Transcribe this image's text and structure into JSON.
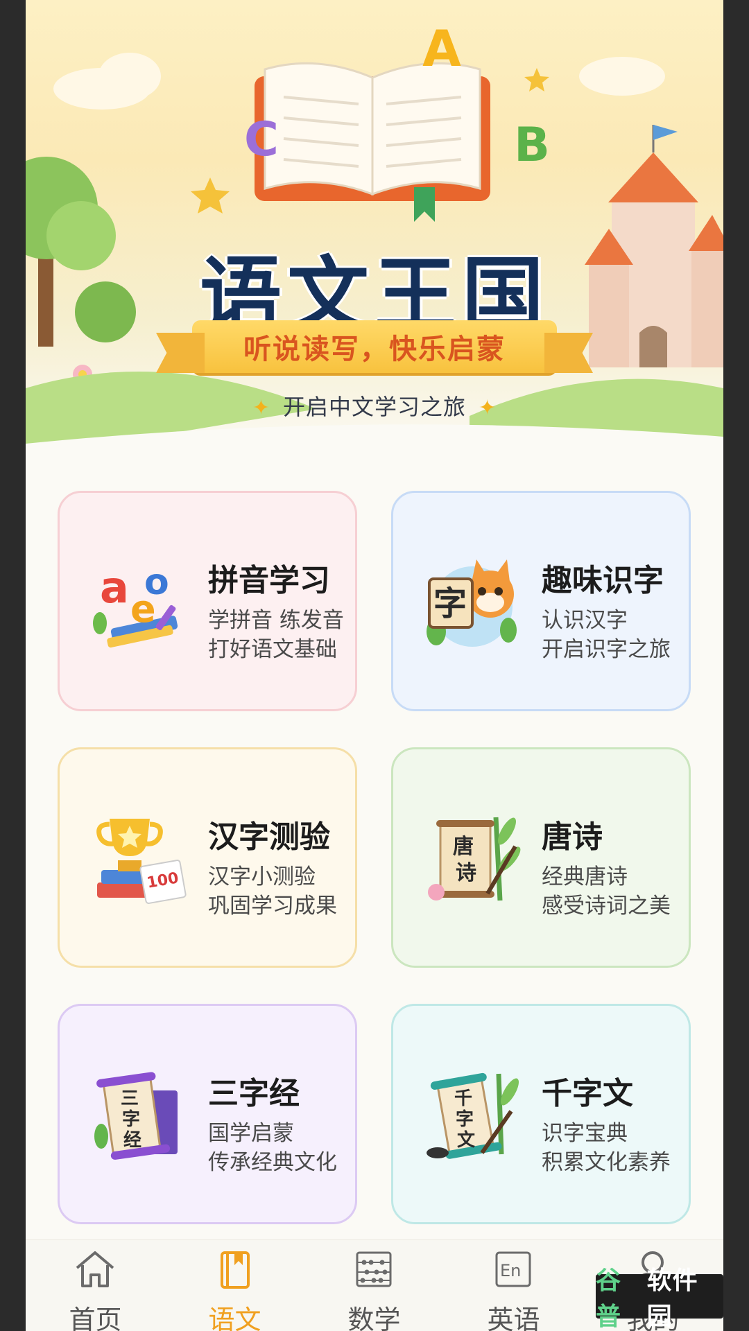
{
  "banner": {
    "title": "语文王国",
    "slogan": "听说读写，快乐启蒙",
    "subtitle": "开启中文学习之旅",
    "letters": [
      "A",
      "B",
      "C"
    ]
  },
  "cards": [
    {
      "title": "拼音学习",
      "line1": "学拼音 练发音",
      "line2": "打好语文基础",
      "icon": "pinyin-aoe-icon",
      "badge": [
        "a",
        "o",
        "e"
      ]
    },
    {
      "title": "趣味识字",
      "line1": "认识汉字",
      "line2": "开启识字之旅",
      "icon": "cat-character-card-icon",
      "badge": [
        "字"
      ]
    },
    {
      "title": "汉字测验",
      "line1": "汉字小测验",
      "line2": "巩固学习成果",
      "icon": "trophy-books-icon",
      "badge": [
        "100"
      ]
    },
    {
      "title": "唐诗",
      "line1": "经典唐诗",
      "line2": "感受诗词之美",
      "icon": "tang-poetry-scroll-icon",
      "badge": [
        "唐",
        "诗"
      ]
    },
    {
      "title": "三字经",
      "line1": "国学启蒙",
      "line2": "传承经典文化",
      "icon": "three-character-classic-scroll-icon",
      "badge": [
        "三",
        "字",
        "经"
      ]
    },
    {
      "title": "千字文",
      "line1": "识字宝典",
      "line2": "积累文化素养",
      "icon": "thousand-character-scroll-icon",
      "badge": [
        "千",
        "字",
        "文"
      ]
    }
  ],
  "nav": [
    {
      "label": "首页",
      "icon": "home-icon",
      "active": false
    },
    {
      "label": "语文",
      "icon": "book-icon",
      "active": true
    },
    {
      "label": "数学",
      "icon": "abacus-icon",
      "active": false
    },
    {
      "label": "英语",
      "icon": "en-icon",
      "active": false
    },
    {
      "label": "我的",
      "icon": "person-icon",
      "active": false
    }
  ],
  "nav_icon_text": {
    "en": "En"
  },
  "watermark": {
    "part1": "谷普",
    "part2": "软件园"
  },
  "colors": {
    "accent": "#f0a020",
    "title": "#14305a",
    "ribbon": "#f8c23e"
  }
}
